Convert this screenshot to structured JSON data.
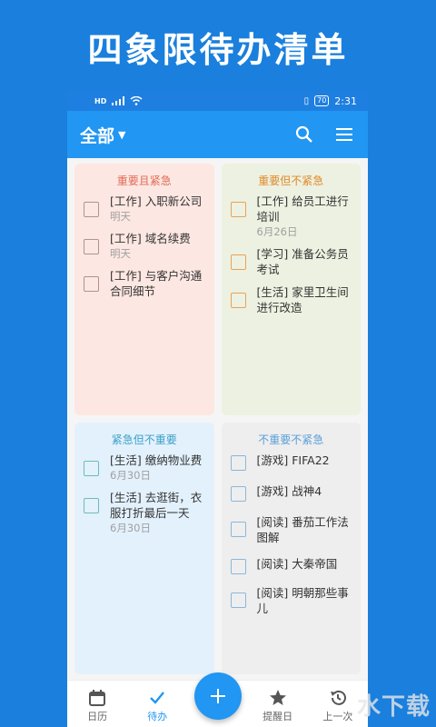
{
  "promo_title": "四象限待办清单",
  "status": {
    "time": "2:31",
    "battery": "70"
  },
  "app_bar": {
    "filter_label": "全部"
  },
  "quadrants": [
    {
      "title": "重要且紧急",
      "title_color": "#e06b55",
      "tasks": [
        {
          "text": "[工作] 入职新公司",
          "date": "明天"
        },
        {
          "text": "[工作] 域名续费",
          "date": "明天"
        },
        {
          "text": "[工作] 与客户沟通合同细节",
          "date": ""
        }
      ]
    },
    {
      "title": "重要但不紧急",
      "title_color": "#e08a2a",
      "tasks": [
        {
          "text": "[工作] 给员工进行培训",
          "date": "6月26日"
        },
        {
          "text": "[学习] 准备公务员考试",
          "date": ""
        },
        {
          "text": "[生活] 家里卫生间进行改造",
          "date": ""
        }
      ]
    },
    {
      "title": "紧急但不重要",
      "title_color": "#3aa0c8",
      "tasks": [
        {
          "text": "[生活] 缴纳物业费",
          "date": "6月30日"
        },
        {
          "text": "[生活] 去逛街，衣服打折最后一天",
          "date": "6月30日"
        }
      ]
    },
    {
      "title": "不重要不紧急",
      "title_color": "#5a9fd8",
      "tasks": [
        {
          "text": "[游戏] FIFA22",
          "date": ""
        },
        {
          "text": "[游戏] 战神4",
          "date": ""
        },
        {
          "text": "[阅读] 番茄工作法图解",
          "date": ""
        },
        {
          "text": "[阅读] 大秦帝国",
          "date": ""
        },
        {
          "text": "[阅读] 明朝那些事儿",
          "date": ""
        }
      ]
    }
  ],
  "bottom_nav": {
    "calendar": "日历",
    "todo": "待办",
    "reminder": "提醒日",
    "previous": "上一次"
  },
  "watermark": "水下载",
  "colors": {
    "accent": "#2196f3",
    "background": "#1a7fdd"
  }
}
